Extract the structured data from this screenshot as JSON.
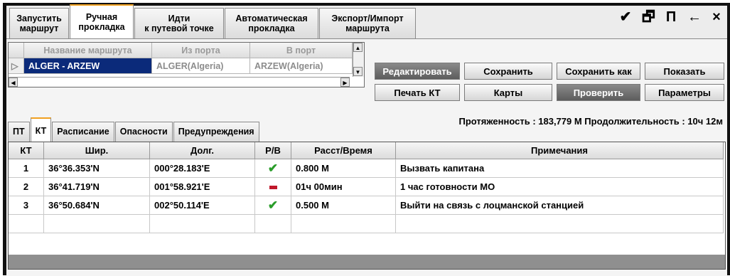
{
  "top_tabs": [
    {
      "label": "Запустить\nмаршрут"
    },
    {
      "label": "Ручная\nпрокладка"
    },
    {
      "label": "Идти\nк путевой точке"
    },
    {
      "label": "Автоматическая\nпрокладка"
    },
    {
      "label": "Экспорт/Импорт\nмаршрута"
    }
  ],
  "window_controls": {
    "pin": "✔",
    "restore": "🗗",
    "dock": "П",
    "back": "←",
    "close": "×"
  },
  "route_grid": {
    "headers": [
      "Название маршрута",
      "Из порта",
      "В порт"
    ],
    "row": {
      "name": "ALGER - ARZEW",
      "from": "ALGER(Algeria)",
      "to": "ARZEW(Algeria)"
    }
  },
  "buttons": {
    "edit": "Редактировать",
    "save": "Сохранить",
    "save_as": "Сохранить как",
    "show": "Показать",
    "print": "Печать КТ",
    "maps": "Карты",
    "check": "Проверить",
    "params": "Параметры"
  },
  "bottom_tabs": [
    "ПТ",
    "КТ",
    "Расписание",
    "Опасности",
    "Предупреждения"
  ],
  "stats": "Протяженность : 183,779 М Продолжительность : 10ч 12м",
  "table": {
    "headers": [
      "КТ",
      "Шир.",
      "Долг.",
      "Р/В",
      "Расст/Время",
      "Примечания"
    ],
    "rows": [
      {
        "kt": "1",
        "lat": "36°36.353'N",
        "lon": "000°28.183'E",
        "rv": "check",
        "dist": "0.800 М",
        "note": "Вызвать капитана"
      },
      {
        "kt": "2",
        "lat": "36°41.719'N",
        "lon": "001°58.921'E",
        "rv": "dash",
        "dist": "01ч 00мин",
        "note": "1 час готовности МО"
      },
      {
        "kt": "3",
        "lat": "36°50.684'N",
        "lon": "002°50.114'E",
        "rv": "check",
        "dist": "0.500 М",
        "note": "Выйти на связь с лоцманской станцией"
      }
    ]
  },
  "colors": {
    "selected_row": "#0b2a7a",
    "check": "#2a9d2a",
    "dash": "#c0182b",
    "active_tab_accent": "#f0a020"
  }
}
